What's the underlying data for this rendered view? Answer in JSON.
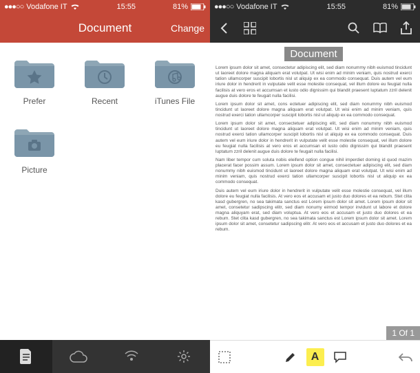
{
  "left": {
    "status": {
      "carrier": "Vodafone IT",
      "time": "15:55",
      "battery": "81%"
    },
    "header": {
      "title": "Document",
      "change_label": "Change"
    },
    "folders": [
      {
        "label": "Prefer",
        "icon": "star"
      },
      {
        "label": "Recent",
        "icon": "clock"
      },
      {
        "label": "iTunes File",
        "icon": "music"
      },
      {
        "label": "Picture",
        "icon": "camera"
      }
    ]
  },
  "right": {
    "status": {
      "carrier": "Vodafone IT",
      "time": "15:55",
      "battery": "81%"
    },
    "document": {
      "title": "Document",
      "page_indicator": "1 Of 1",
      "body": [
        "Lorem ipsum dolor sit amet, consectetur adipiscing elit, sed diam nonummy nibh euismod tincidunt ut laoreet dolore magna aliquam erat volutpat. Ut wisi enim ad minim veniam, quis nostrud exerci tation ullamcorper suscipit lobortis nisl ut aliquip ex ea commodo consequat. Duis autem vel eum iriure dolor in hendrerit in vulputate velit esse molestie consequat, vel illum dolore eu feugiat nulla facilisis at vero eros et accumsan et iusto odio dignissim qui blandit praesent luptatum zzril delenit augue duis dolore te feugait nulla facilisi.",
        "Lorem ipsum dolor sit amet, cons ectetuer adipiscing elit, sed diam nonummy nibh euismod tincidunt ut laoreet dolore magna aliquam erat volutpat. Ut wisi enim ad minim veniam, quis nostrud exerci tation ullamcorper suscipit lobortis nisl ut aliquip ex ea commodo consequat.",
        "Lorem ipsum dolor sit amet, consectetuer adipiscing elit, sed diam nonummy nibh euismod tincidunt ut laoreet dolore magna aliquam erat volutpat. Ut wisi enim ad minim veniam, quis nostrud exerci tation ullamcorper suscipit lobortis nisl ut aliquip ex ea commodo consequat. Duis autem vel eum iriure dolor in hendrerit in vulputate velit esse molestie consequat, vel illum dolore eu feugiat nulla facilisis at vero eros et accumsan et iusto odio dignissim qui blandit praesent luptatum zzril delenit augue duis dolore te feugait nulla facilisi.",
        "Nam liber tempor cum soluta nobis eleifend option congue nihil imperdiet doming id quod mazim placerat facer possim assum. Lorem ipsum dolor sit amet, consectetuer adipiscing elit, sed diam nonummy nibh euismod tincidunt ut laoreet dolore magna aliquam erat volutpat. Ut wisi enim ad minim veniam, quis nostrud exerci tation ullamcorper suscipit lobortis nisl ut aliquip ex ea commodo consequat.",
        "Duis autem vel eum iriure dolor in hendrerit in vulputate velit esse molestie consequat, vel illum dolore eu feugiat nulla facilisis. At vero eos et accusam et justo duo dolores et ea rebum. Stet clita kasd gubergren, no sea takimata sanctus est Lorem ipsum dolor sit amet. Lorem ipsum dolor sit amet, consetetur sadipscing elitr, sed diam nonumy eirmod tempor invidunt ut labore et dolore magna aliquyam erat, sed diam voluptua. At vero eos et accusam et justo duo dolores et ea rebum. Stet clita kasd gubergren, no sea takimata sanctus est Lorem ipsum dolor sit amet. Lorem ipsum dolor sit amet, consetetur sadipscing elitr. At vero eos et accusam et justo duo dolores et ea rebum."
      ]
    }
  },
  "colors": {
    "brand_red": "#c44838",
    "dark": "#2c2c2c",
    "folder": "#7a95a8",
    "highlight": "#fcee4f"
  }
}
